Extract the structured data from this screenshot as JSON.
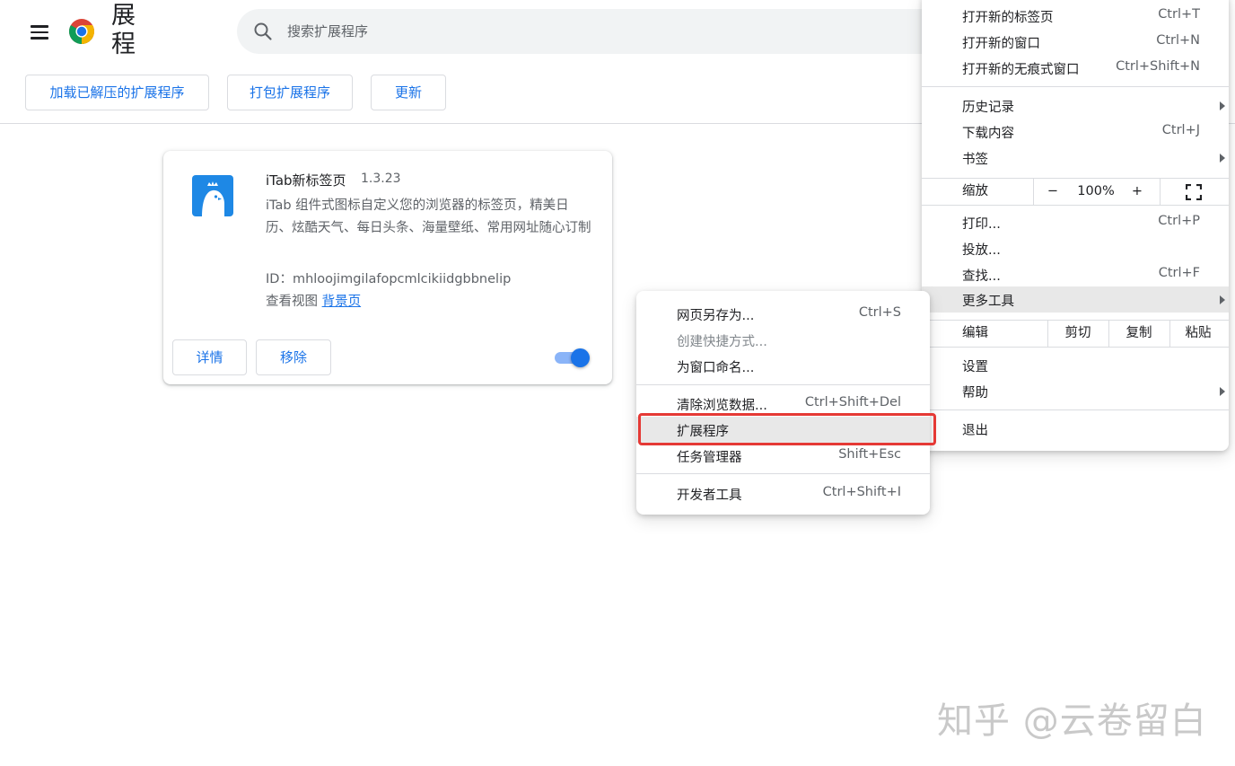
{
  "header": {
    "title": "展程",
    "search_placeholder": "搜索扩展程序",
    "load_unpacked": "加载已解压的扩展程序",
    "pack_extension": "打包扩展程序",
    "update": "更新"
  },
  "extension": {
    "name": "iTab新标签页",
    "version": "1.3.23",
    "description": "iTab 组件式图标自定义您的浏览器的标签页，精美日历、炫酷天气、每日头条、海量壁纸、常用网址随心订制",
    "id": "ID：mhloojimgilafopcmlcikiidgbbnelip",
    "views_label": "查看视图",
    "views_link": "背景页",
    "details_button": "详情",
    "remove_button": "移除",
    "enabled": true
  },
  "main_menu": {
    "new_tab": "打开新的标签页",
    "new_tab_sc": "Ctrl+T",
    "new_window": "打开新的窗口",
    "new_window_sc": "Ctrl+N",
    "incognito": "打开新的无痕式窗口",
    "incognito_sc": "Ctrl+Shift+N",
    "history": "历史记录",
    "downloads": "下载内容",
    "downloads_sc": "Ctrl+J",
    "bookmarks": "书签",
    "zoom": "缩放",
    "zoom_minus": "−",
    "zoom_level": "100%",
    "zoom_plus": "+",
    "print": "打印...",
    "print_sc": "Ctrl+P",
    "cast": "投放...",
    "find": "查找...",
    "find_sc": "Ctrl+F",
    "more_tools": "更多工具",
    "edit": "编辑",
    "cut": "剪切",
    "copy": "复制",
    "paste": "粘贴",
    "settings": "设置",
    "help": "帮助",
    "exit": "退出"
  },
  "sub_menu": {
    "save_page": "网页另存为...",
    "save_page_sc": "Ctrl+S",
    "create_shortcut": "创建快捷方式...",
    "name_window": "为窗口命名...",
    "clear_data": "清除浏览数据...",
    "clear_data_sc": "Ctrl+Shift+Del",
    "extensions": "扩展程序",
    "task_manager": "任务管理器",
    "task_manager_sc": "Shift+Esc",
    "dev_tools": "开发者工具",
    "dev_tools_sc": "Ctrl+Shift+I"
  },
  "watermark": "知乎 @云卷留白",
  "colors": {
    "accent": "#1a73e8",
    "highlight": "#e53935",
    "menu_hover": "#e8e8e8"
  }
}
